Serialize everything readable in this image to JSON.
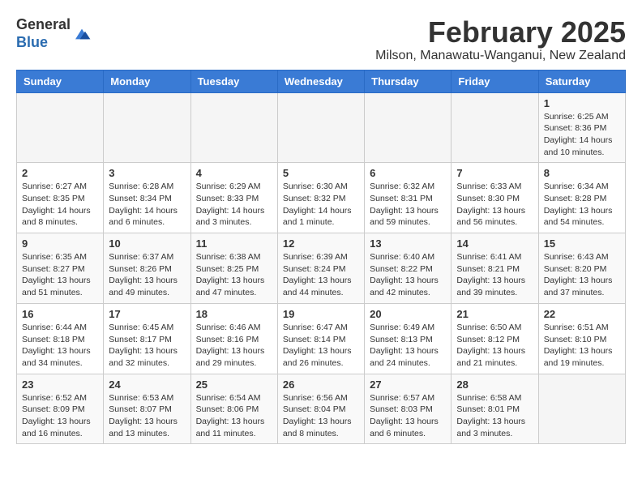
{
  "header": {
    "logo_general": "General",
    "logo_blue": "Blue",
    "month_title": "February 2025",
    "location": "Milson, Manawatu-Wanganui, New Zealand"
  },
  "weekdays": [
    "Sunday",
    "Monday",
    "Tuesday",
    "Wednesday",
    "Thursday",
    "Friday",
    "Saturday"
  ],
  "weeks": [
    [
      {
        "day": "",
        "info": ""
      },
      {
        "day": "",
        "info": ""
      },
      {
        "day": "",
        "info": ""
      },
      {
        "day": "",
        "info": ""
      },
      {
        "day": "",
        "info": ""
      },
      {
        "day": "",
        "info": ""
      },
      {
        "day": "1",
        "info": "Sunrise: 6:25 AM\nSunset: 8:36 PM\nDaylight: 14 hours\nand 10 minutes."
      }
    ],
    [
      {
        "day": "2",
        "info": "Sunrise: 6:27 AM\nSunset: 8:35 PM\nDaylight: 14 hours\nand 8 minutes."
      },
      {
        "day": "3",
        "info": "Sunrise: 6:28 AM\nSunset: 8:34 PM\nDaylight: 14 hours\nand 6 minutes."
      },
      {
        "day": "4",
        "info": "Sunrise: 6:29 AM\nSunset: 8:33 PM\nDaylight: 14 hours\nand 3 minutes."
      },
      {
        "day": "5",
        "info": "Sunrise: 6:30 AM\nSunset: 8:32 PM\nDaylight: 14 hours\nand 1 minute."
      },
      {
        "day": "6",
        "info": "Sunrise: 6:32 AM\nSunset: 8:31 PM\nDaylight: 13 hours\nand 59 minutes."
      },
      {
        "day": "7",
        "info": "Sunrise: 6:33 AM\nSunset: 8:30 PM\nDaylight: 13 hours\nand 56 minutes."
      },
      {
        "day": "8",
        "info": "Sunrise: 6:34 AM\nSunset: 8:28 PM\nDaylight: 13 hours\nand 54 minutes."
      }
    ],
    [
      {
        "day": "9",
        "info": "Sunrise: 6:35 AM\nSunset: 8:27 PM\nDaylight: 13 hours\nand 51 minutes."
      },
      {
        "day": "10",
        "info": "Sunrise: 6:37 AM\nSunset: 8:26 PM\nDaylight: 13 hours\nand 49 minutes."
      },
      {
        "day": "11",
        "info": "Sunrise: 6:38 AM\nSunset: 8:25 PM\nDaylight: 13 hours\nand 47 minutes."
      },
      {
        "day": "12",
        "info": "Sunrise: 6:39 AM\nSunset: 8:24 PM\nDaylight: 13 hours\nand 44 minutes."
      },
      {
        "day": "13",
        "info": "Sunrise: 6:40 AM\nSunset: 8:22 PM\nDaylight: 13 hours\nand 42 minutes."
      },
      {
        "day": "14",
        "info": "Sunrise: 6:41 AM\nSunset: 8:21 PM\nDaylight: 13 hours\nand 39 minutes."
      },
      {
        "day": "15",
        "info": "Sunrise: 6:43 AM\nSunset: 8:20 PM\nDaylight: 13 hours\nand 37 minutes."
      }
    ],
    [
      {
        "day": "16",
        "info": "Sunrise: 6:44 AM\nSunset: 8:18 PM\nDaylight: 13 hours\nand 34 minutes."
      },
      {
        "day": "17",
        "info": "Sunrise: 6:45 AM\nSunset: 8:17 PM\nDaylight: 13 hours\nand 32 minutes."
      },
      {
        "day": "18",
        "info": "Sunrise: 6:46 AM\nSunset: 8:16 PM\nDaylight: 13 hours\nand 29 minutes."
      },
      {
        "day": "19",
        "info": "Sunrise: 6:47 AM\nSunset: 8:14 PM\nDaylight: 13 hours\nand 26 minutes."
      },
      {
        "day": "20",
        "info": "Sunrise: 6:49 AM\nSunset: 8:13 PM\nDaylight: 13 hours\nand 24 minutes."
      },
      {
        "day": "21",
        "info": "Sunrise: 6:50 AM\nSunset: 8:12 PM\nDaylight: 13 hours\nand 21 minutes."
      },
      {
        "day": "22",
        "info": "Sunrise: 6:51 AM\nSunset: 8:10 PM\nDaylight: 13 hours\nand 19 minutes."
      }
    ],
    [
      {
        "day": "23",
        "info": "Sunrise: 6:52 AM\nSunset: 8:09 PM\nDaylight: 13 hours\nand 16 minutes."
      },
      {
        "day": "24",
        "info": "Sunrise: 6:53 AM\nSunset: 8:07 PM\nDaylight: 13 hours\nand 13 minutes."
      },
      {
        "day": "25",
        "info": "Sunrise: 6:54 AM\nSunset: 8:06 PM\nDaylight: 13 hours\nand 11 minutes."
      },
      {
        "day": "26",
        "info": "Sunrise: 6:56 AM\nSunset: 8:04 PM\nDaylight: 13 hours\nand 8 minutes."
      },
      {
        "day": "27",
        "info": "Sunrise: 6:57 AM\nSunset: 8:03 PM\nDaylight: 13 hours\nand 6 minutes."
      },
      {
        "day": "28",
        "info": "Sunrise: 6:58 AM\nSunset: 8:01 PM\nDaylight: 13 hours\nand 3 minutes."
      },
      {
        "day": "",
        "info": ""
      }
    ]
  ]
}
